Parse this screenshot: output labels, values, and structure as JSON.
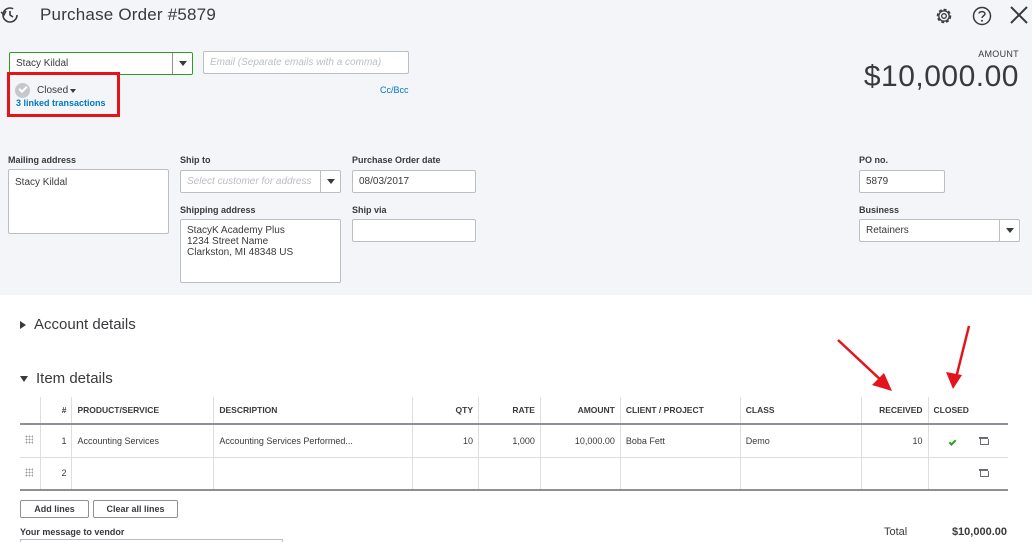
{
  "header": {
    "title": "Purchase Order #5879",
    "amount_label": "AMOUNT",
    "amount_value": "$10,000.00"
  },
  "vendor": {
    "value": "Stacy Kildal"
  },
  "email": {
    "placeholder": "Email (Separate emails with a comma)",
    "cc_bcc": "Cc/Bcc"
  },
  "status": {
    "label": "Closed",
    "linked": "3 linked transactions"
  },
  "fields": {
    "mailing_address_label": "Mailing address",
    "mailing_address_value": "Stacy Kildal",
    "ship_to_label": "Ship to",
    "ship_to_placeholder": "Select customer for address",
    "shipping_address_label": "Shipping address",
    "shipping_address_lines": [
      "StacyK Academy Plus",
      "1234 Street Name",
      "Clarkston, MI  48348 US"
    ],
    "po_date_label": "Purchase Order date",
    "po_date_value": "08/03/2017",
    "ship_via_label": "Ship via",
    "ship_via_value": "",
    "po_no_label": "PO no.",
    "po_no_value": "5879",
    "business_label": "Business",
    "business_value": "Retainers"
  },
  "sections": {
    "account_details": "Account details",
    "item_details": "Item details"
  },
  "table": {
    "headers": [
      "#",
      "PRODUCT/SERVICE",
      "DESCRIPTION",
      "QTY",
      "RATE",
      "AMOUNT",
      "CLIENT / PROJECT",
      "CLASS",
      "RECEIVED",
      "CLOSED"
    ],
    "rows": [
      {
        "num": "1",
        "product": "Accounting Services",
        "description": "Accounting Services Performed...",
        "qty": "10",
        "rate": "1,000",
        "amount": "10,000.00",
        "client": "Boba Fett",
        "class": "Demo",
        "received": "10",
        "closed": true
      },
      {
        "num": "2",
        "product": "",
        "description": "",
        "qty": "",
        "rate": "",
        "amount": "",
        "client": "",
        "class": "",
        "received": "",
        "closed": false
      }
    ]
  },
  "buttons": {
    "add_lines": "Add lines",
    "clear_all_lines": "Clear all lines"
  },
  "footer": {
    "message_label": "Your message to vendor",
    "total_label": "Total",
    "total_value": "$10,000.00"
  },
  "colors": {
    "accent_green": "#2ca01c",
    "link_blue": "#0077c5",
    "annotation_red": "#e3141c",
    "panel_bg": "#f4f5f8"
  },
  "icons": [
    "history-icon",
    "gear-icon",
    "help-icon",
    "close-icon",
    "chevron-down-icon",
    "check-icon",
    "drag-handle-icon",
    "trash-icon"
  ]
}
